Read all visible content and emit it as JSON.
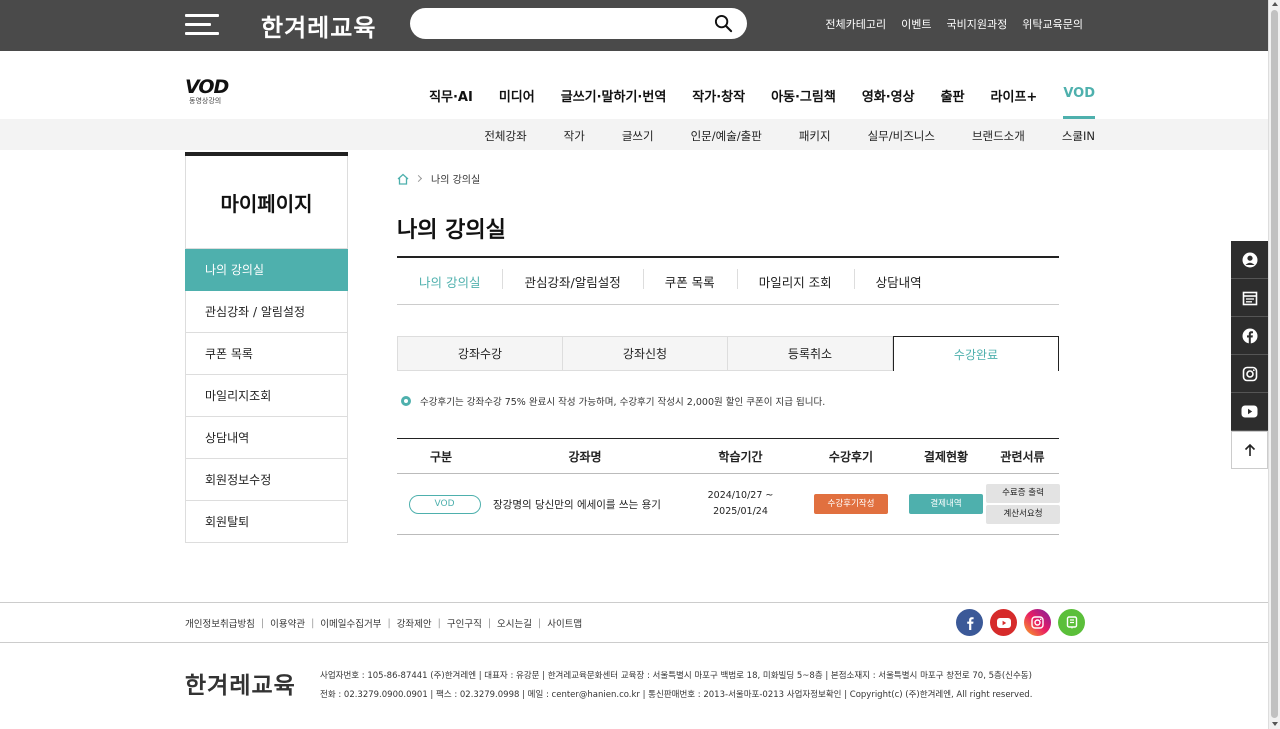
{
  "header": {
    "brand": "한겨레교육",
    "search_placeholder": "",
    "top_links": [
      "전체카테고리",
      "이벤트",
      "국비지원과정",
      "위탁교육문의"
    ]
  },
  "vod_logo": {
    "big": "VOD",
    "small": "동영상강의"
  },
  "main_nav": [
    "직무·AI",
    "미디어",
    "글쓰기·말하기·번역",
    "작가·창작",
    "아동·그림책",
    "영화·영상",
    "출판",
    "라이프+",
    "VOD"
  ],
  "main_nav_active": "VOD",
  "sub_nav": [
    "전체강좌",
    "작가",
    "글쓰기",
    "인문/예술/출판",
    "패키지",
    "실무/비즈니스",
    "브랜드소개",
    "스쿨IN"
  ],
  "sidebar": {
    "title": "마이페이지",
    "items": [
      "나의 강의실",
      "관심강좌 / 알림설정",
      "쿠폰 목록",
      "마일리지조회",
      "상담내역",
      "회원정보수정",
      "회원탈퇴"
    ]
  },
  "breadcrumb": {
    "current": "나의 강의실"
  },
  "page_title": "나의 강의실",
  "tabs1": [
    "나의 강의실",
    "관심강좌/알림설정",
    "쿠폰 목록",
    "마일리지 조회",
    "상담내역"
  ],
  "tabs2": [
    "강좌수강",
    "강좌신청",
    "등록취소",
    "수강완료"
  ],
  "notice": "수강후기는 강좌수강 75% 완료시 작성 가능하며, 수강후기 작성시 2,000원 할인 쿠폰이 지급 됩니다.",
  "table": {
    "headers": [
      "구분",
      "강좌명",
      "학습기간",
      "수강후기",
      "결제현황",
      "관련서류"
    ],
    "rows": [
      {
        "type": "VOD",
        "course": "장강명의 당신만의 에세이를 쓰는 용기",
        "period_start": "2024/10/27 ~",
        "period_end": "2025/01/24",
        "review_btn": "수강후기작성",
        "pay_btn": "결제내역",
        "doc_btn1": "수료증 출력",
        "doc_btn2": "계산서요청"
      }
    ]
  },
  "footer": {
    "links": [
      "개인정보취급방침",
      "이용약관",
      "이메일수집거부",
      "강좌제안",
      "구인구직",
      "오시는길",
      "사이트맵"
    ],
    "brand": "한겨레교육",
    "info_line1": "사업자번호 : 105-86-87441 (주)한겨레엔   |   대표자 : 유강문   |   한겨레교육문화센터 교육장 : 서울특별시 마포구 백범로 18, 미화빌딩 5~8층   |   본점소재지 : 서울특별시 마포구 창전로 70, 5층(신수동)",
    "info_line2": "전화 : 02.3279.0900.0901   |   팩스 : 02.3279.0998   |   메일 : center@hanien.co.kr   |   통신판매번호 : 2013-서울마포-0213 사업자정보확인   |   Copyright(c) (주)한겨레엔, All right reserved."
  },
  "colors": {
    "accent": "#4eb0ad",
    "topbar": "#4a4a4a",
    "review": "#e1703f"
  }
}
